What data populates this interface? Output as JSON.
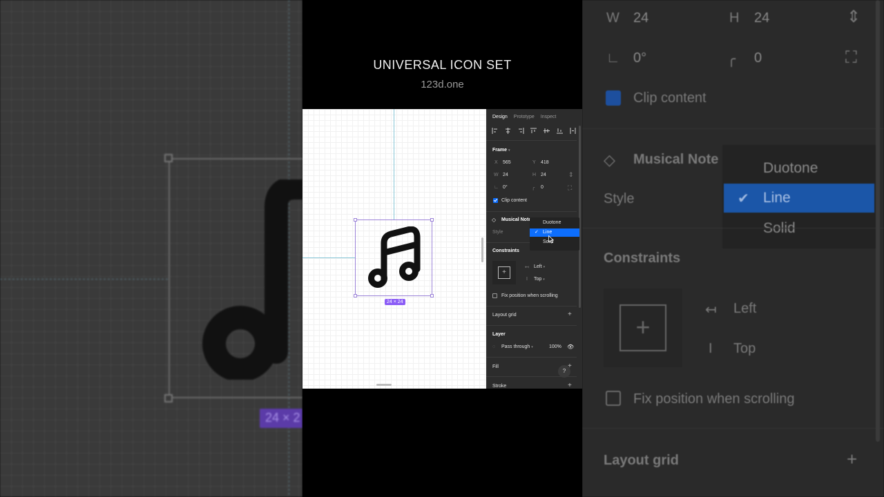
{
  "header": {
    "title": "UNIVERSAL ICON SET",
    "subtitle": "123d.one"
  },
  "canvas": {
    "size_badge": "24 × 24",
    "icon": "musical-note-icon"
  },
  "panel": {
    "tabs": [
      "Design",
      "Prototype",
      "Inspect"
    ],
    "frame": {
      "section": "Frame",
      "x_label": "X",
      "x_value": "565",
      "y_label": "Y",
      "y_value": "418",
      "w_label": "W",
      "w_value": "24",
      "h_label": "H",
      "h_value": "24",
      "rotation_value": "0°",
      "radius_value": "0",
      "clip_content": "Clip content"
    },
    "component": {
      "name": "Musical Note",
      "style_label": "Style"
    },
    "constraints": {
      "section": "Constraints",
      "horizontal": "Left",
      "vertical": "Top",
      "fix_position": "Fix position when scrolling"
    },
    "layout_grid": "Layout grid",
    "layer": {
      "section": "Layer",
      "blend": "Pass through",
      "opacity": "100%"
    },
    "fill": "Fill",
    "stroke": "Stroke",
    "help": "?"
  },
  "dropdown": {
    "options": [
      "Duotone",
      "Line",
      "Solid"
    ],
    "selected": "Line"
  },
  "backdrop_right": {
    "w_label": "W",
    "w_value": "24",
    "h_label": "H",
    "h_value": "24",
    "rotation_value": "0°",
    "radius_value": "0",
    "clip_content": "Clip content",
    "component_name": "Musical Note",
    "style_label": "Style",
    "options": [
      "Duotone",
      "Line",
      "Solid"
    ],
    "constraints": "Constraints",
    "horizontal": "Left",
    "vertical": "Top",
    "fix_position": "Fix position when scrolling",
    "layout_grid": "Layout grid"
  },
  "backdrop_left": {
    "size_badge": "24 × 2"
  },
  "colors": {
    "accent": "#0d6efd",
    "selection": "#9b82d8",
    "badge": "#8b5cf6"
  }
}
